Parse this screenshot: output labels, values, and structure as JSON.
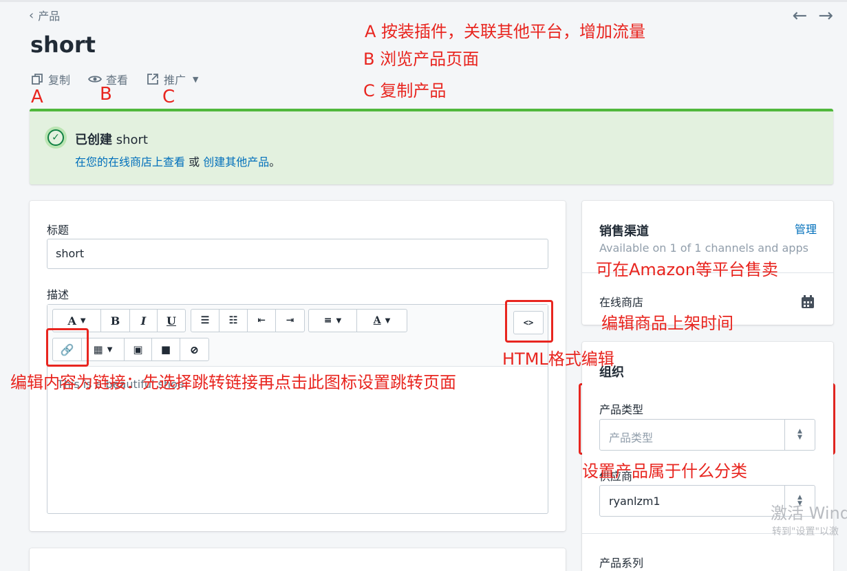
{
  "header": {
    "breadcrumb": "产品",
    "title": "short",
    "prev_icon": "arrow-left-icon",
    "next_icon": "arrow-right-icon"
  },
  "actions": [
    {
      "label": "复制",
      "icon": "duplicate-icon"
    },
    {
      "label": "查看",
      "icon": "eye-icon"
    },
    {
      "label": "推广",
      "icon": "external-icon"
    }
  ],
  "annotations": {
    "letter_a": "A",
    "letter_b": "B",
    "letter_c": "C",
    "line_a": "A  按装插件，关联其他平台，增加流量",
    "line_b": "B  浏览产品页面",
    "line_c": "C  复制产品",
    "amazon": "可在Amazon等平台售卖",
    "schedule": "编辑商品上架时间",
    "html_edit": "HTML格式编辑",
    "link_note": "编辑内容为链接：先选择跳转链接再点击此图标设置跳转页面",
    "category_note": "设置产品属于什么分类",
    "color": "#e8251f"
  },
  "banner": {
    "prefix": "已创建",
    "name": "short",
    "link1": "在您的在线商店上查看",
    "or": "或",
    "link2": "创建其他产品",
    "period": "。",
    "accent": "#50b83c"
  },
  "form": {
    "title_label": "标题",
    "title_value": "short",
    "desc_label": "描述",
    "desc_value": "This is a beautiful shoe.",
    "toolbar": {
      "font": "A",
      "bold": "B",
      "italic": "I",
      "underline": "U",
      "code": "<>"
    }
  },
  "sales": {
    "title": "销售渠道",
    "manage": "管理",
    "subtitle": "Available on 1 of 1 channels and apps",
    "online_store": "在线商店"
  },
  "organization": {
    "title": "组织",
    "type_label": "产品类型",
    "type_placeholder": "产品类型",
    "vendor_label": "供应商",
    "vendor_value": "ryanlzm1",
    "collections_label": "产品系列"
  },
  "watermark": {
    "line1": "激活 Wind",
    "line2": "转到\"设置\"以激"
  }
}
